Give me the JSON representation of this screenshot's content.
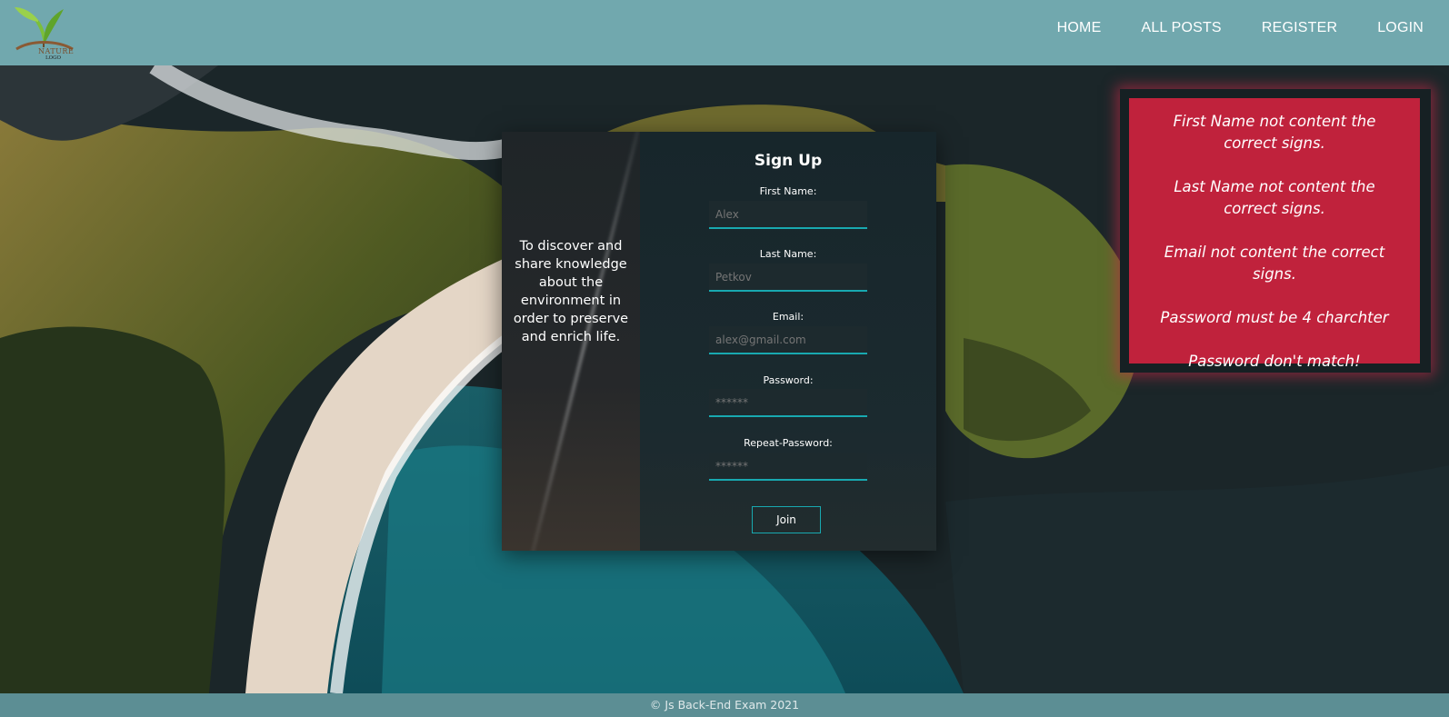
{
  "header": {
    "logo_text": "NATURE",
    "logo_subtext": "LOGO",
    "nav": [
      {
        "label": "HOME"
      },
      {
        "label": "ALL POSTS"
      },
      {
        "label": "REGISTER"
      },
      {
        "label": "LOGIN"
      }
    ]
  },
  "card": {
    "tagline": "To discover and share knowledge about the environment in order to preserve and enrich life.",
    "title": "Sign Up",
    "fields": {
      "first_name": {
        "label": "First Name:",
        "placeholder": "Alex"
      },
      "last_name": {
        "label": "Last Name:",
        "placeholder": "Petkov"
      },
      "email": {
        "label": "Email:",
        "placeholder": "alex@gmail.com"
      },
      "password": {
        "label": "Password:",
        "placeholder": "******"
      },
      "repeat_password": {
        "label": "Repeat-Password:",
        "placeholder": "******"
      }
    },
    "submit_label": "Join"
  },
  "errors": [
    "First Name not content the correct signs.",
    "Last Name not content the correct signs.",
    "Email not content the correct signs.",
    "Password must be 4 charchter",
    "Password don't match!"
  ],
  "footer": {
    "text": "© Js Back-End Exam 2021"
  },
  "colors": {
    "header": "#71a8ae",
    "accent": "#18a9b0",
    "error": "#c0223c",
    "footer": "#5c8e94"
  }
}
